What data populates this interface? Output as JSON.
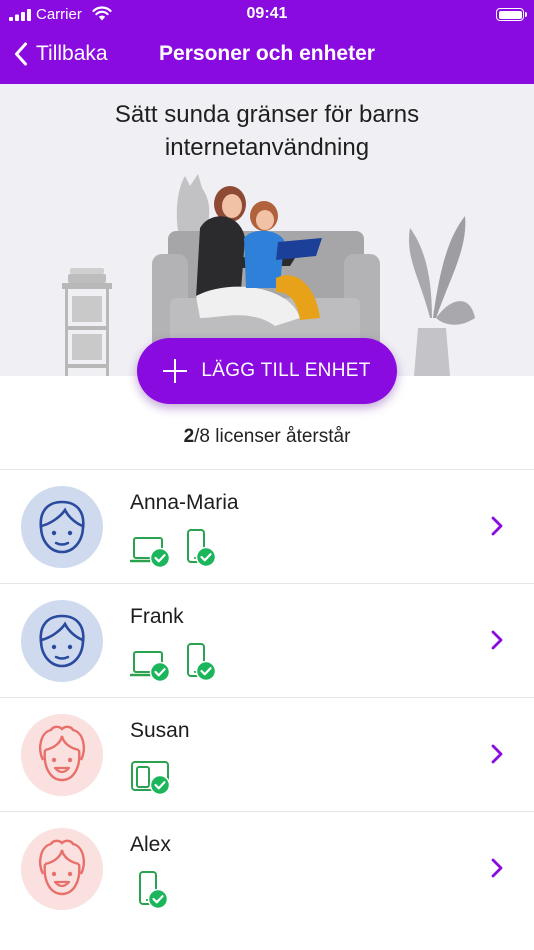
{
  "status_bar": {
    "carrier": "Carrier",
    "time": "09:41"
  },
  "nav": {
    "back_label": "Tillbaka",
    "title": "Personer och enheter"
  },
  "hero": {
    "title": "Sätt sunda gränser för barns internetanvändning"
  },
  "add_button": {
    "label": "LÄGG TILL ENHET"
  },
  "licenses": {
    "count": "2",
    "rest": "/8 licenser återstår"
  },
  "colors": {
    "brand": "#8a0be0",
    "ok": "#1bb55c",
    "device": "#2aa24f",
    "avatar_blue": "#cfdaef",
    "avatar_pink": "#fbe0e0"
  },
  "people": [
    {
      "name": "Anna-Maria",
      "avatar": "boy-face-icon",
      "devices": [
        "laptop-check-icon",
        "phone-check-icon"
      ]
    },
    {
      "name": "Frank",
      "avatar": "boy-face-icon",
      "devices": [
        "laptop-check-icon",
        "phone-check-icon"
      ]
    },
    {
      "name": "Susan",
      "avatar": "girl-face-icon",
      "devices": [
        "multi-device-check-icon"
      ]
    },
    {
      "name": "Alex",
      "avatar": "girl-face-icon",
      "devices": [
        "phone-check-icon"
      ]
    }
  ]
}
